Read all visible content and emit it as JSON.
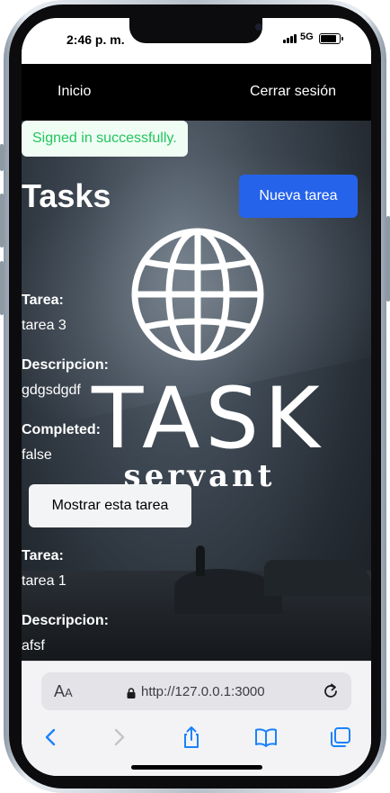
{
  "status_bar": {
    "time": "2:46 p. m.",
    "network": "5G"
  },
  "nav": {
    "home_label": "Inicio",
    "logout_label": "Cerrar sesión"
  },
  "flash": {
    "message": "Signed in successfully."
  },
  "page": {
    "title": "Tasks",
    "new_task_label": "Nueva tarea"
  },
  "logo": {
    "main_text": "TASK",
    "sub_text": "servant"
  },
  "tasks": [
    {
      "tarea_label": "Tarea:",
      "tarea_value": "tarea 3",
      "descripcion_label": "Descripcion:",
      "descripcion_value": "gdgsdgdf",
      "completed_label": "Completed:",
      "completed_value": "false",
      "show_label": "Mostrar esta tarea"
    },
    {
      "tarea_label": "Tarea:",
      "tarea_value": "tarea 1",
      "descripcion_label": "Descripcion:",
      "descripcion_value": "afsf"
    }
  ],
  "browser": {
    "text_size_label": "A",
    "text_size_label_small": "A",
    "url": "http://127.0.0.1:3000"
  },
  "colors": {
    "nav_bg": "#000000",
    "primary_button": "#2563eb",
    "flash_text": "#22c55e",
    "flash_bg": "#f0fdf4",
    "safari_blue": "#1a82fb"
  },
  "icons": [
    "lock-icon",
    "reload-icon",
    "back-icon",
    "forward-icon",
    "share-icon",
    "bookmarks-icon",
    "tabs-icon",
    "globe-icon"
  ]
}
